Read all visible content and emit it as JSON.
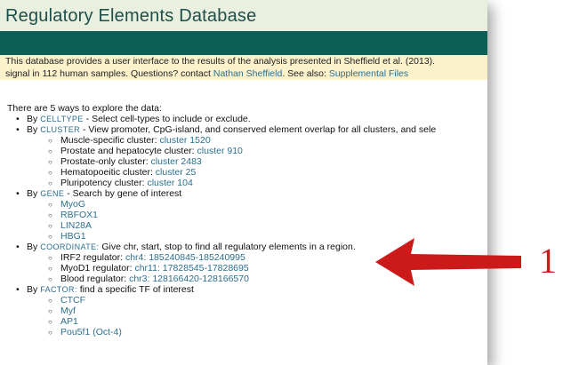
{
  "header": {
    "title": "Regulatory Elements Database"
  },
  "intro": {
    "line1": "This database provides a user interface to the results of the analysis presented in Sheffield et al. (2013).",
    "line2_prefix": "signal in 112 human samples. Questions? contact ",
    "contact_link": "Nathan Sheffield",
    "line2_mid": ". See also: ",
    "supplemental_link": "Supplemental Files"
  },
  "intro_text": "There are 5 ways to explore the data:",
  "sections": {
    "celltype": {
      "by": "By",
      "cap": "CELLTYPE",
      "rest": " - Select cell-types to include or exclude."
    },
    "cluster": {
      "by": "By",
      "cap": "CLUSTER",
      "rest": " - View promoter, CpG-island, and conserved element overlap for all clusters, and sele",
      "items": [
        {
          "label": "Muscle-specific cluster: ",
          "link": "cluster 1520"
        },
        {
          "label": "Prostate and hepatocyte cluster: ",
          "link": "cluster 910"
        },
        {
          "label": "Prostate-only cluster: ",
          "link": "cluster 2483"
        },
        {
          "label": "Hematopoeitic cluster: ",
          "link": "cluster 25"
        },
        {
          "label": "Pluripotency cluster: ",
          "link": "cluster 104"
        }
      ]
    },
    "gene": {
      "by": "By",
      "cap": "GENE",
      "rest": " - Search by gene of interest",
      "items": [
        "MyoG",
        "RBFOX1",
        "LIN28A",
        "HBG1"
      ]
    },
    "coordinate": {
      "by": "By",
      "cap": "COORDINATE:",
      "rest": " Give chr, start, stop to find all regulatory elements in a region.",
      "items": [
        {
          "label": "IRF2 regulator: ",
          "link": "chr4: 185240845-185240995"
        },
        {
          "label": "MyoD1 regulator: ",
          "link": "chr11: 17828545-17828695"
        },
        {
          "label": "Blood regulator: ",
          "link": "chr3: 128166420-128166570"
        }
      ]
    },
    "factor": {
      "by": "By",
      "cap": "FACTOR:",
      "rest": " find a specific TF of interest",
      "items": [
        "CTCF",
        "Myf",
        "AP1",
        "Pou5f1 (Oct-4)"
      ]
    }
  },
  "callout": {
    "number": "1",
    "color": "#cc1a1a"
  },
  "colors": {
    "title_bg": "#e9f0df",
    "band": "#0c5f54",
    "intro_bg": "#fbf2cc",
    "link": "#2b6f8e"
  }
}
